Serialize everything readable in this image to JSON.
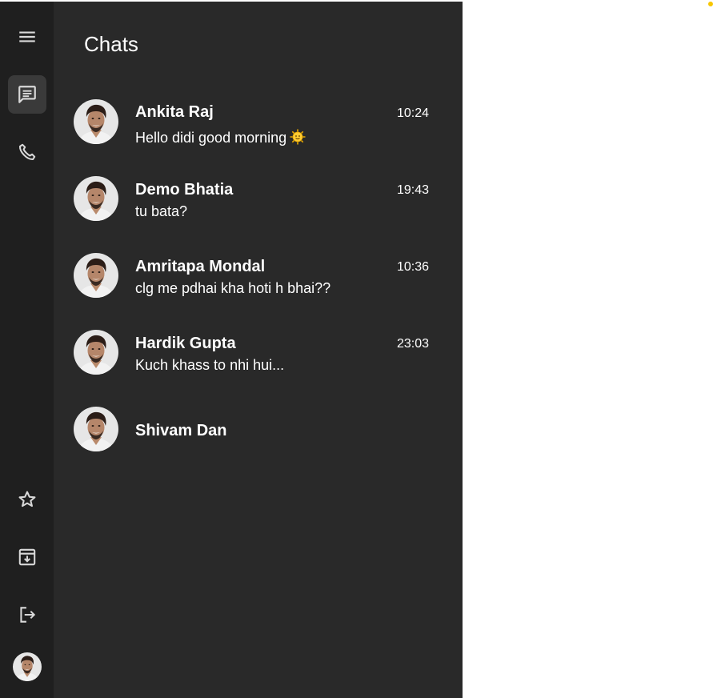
{
  "header": {
    "title": "Chats"
  },
  "colors": {
    "rail": "#1f1f1f",
    "panel": "#292929",
    "active": "#3a3a3a",
    "icon": "#d9d9d9",
    "indicator": "#f7c600"
  },
  "rail": {
    "top_icons": [
      "menu-icon",
      "chat-icon",
      "phone-icon"
    ],
    "bottom_icons": [
      "star-icon",
      "archive-icon",
      "logout-icon"
    ],
    "active": "chat-icon"
  },
  "chats": [
    {
      "name": "Ankita Raj",
      "time": "10:24",
      "message": "Hello didi good morning",
      "emoji": "sun-with-face"
    },
    {
      "name": "Demo Bhatia",
      "time": "19:43",
      "message": "tu bata?"
    },
    {
      "name": "Amritapa Mondal",
      "time": "10:36",
      "message": "clg me pdhai kha hoti h bhai??"
    },
    {
      "name": "Hardik Gupta",
      "time": "23:03",
      "message": "Kuch khass to nhi hui..."
    },
    {
      "name": "Shivam Dan",
      "time": "",
      "message": ""
    }
  ]
}
